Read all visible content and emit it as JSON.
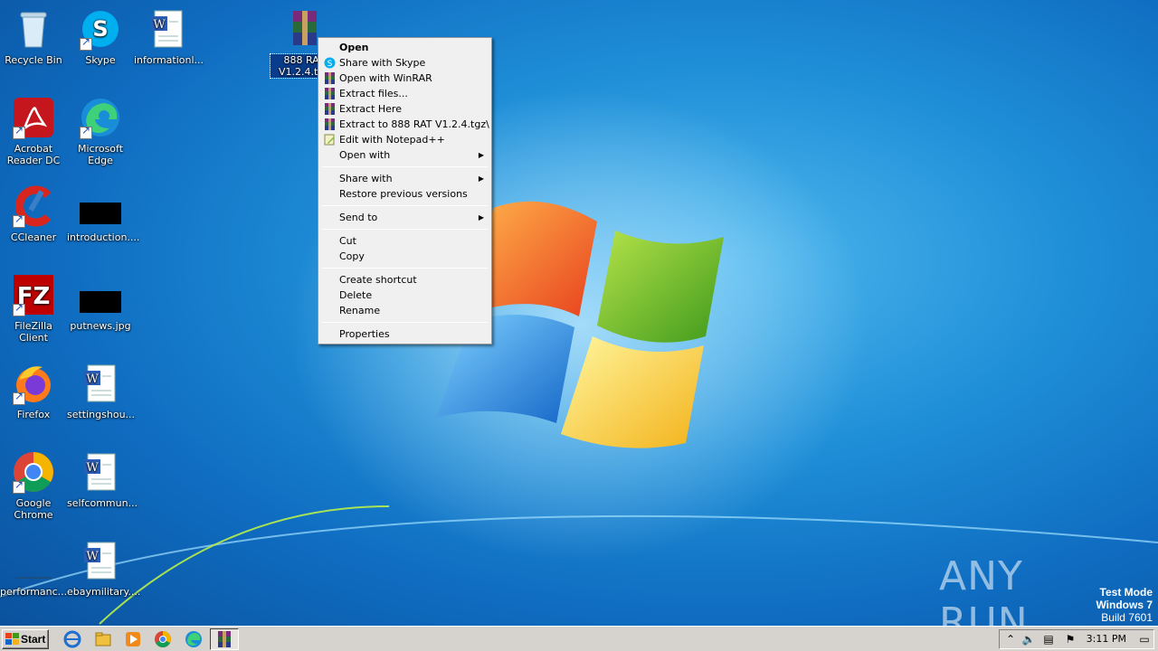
{
  "desktop": {
    "icons": [
      {
        "label": "Recycle Bin"
      },
      {
        "label": "Skype"
      },
      {
        "label": "informationl..."
      },
      {
        "label": "888 RAT V1.2.4.tgz"
      },
      {
        "label": "Acrobat Reader DC"
      },
      {
        "label": "Microsoft Edge"
      },
      {
        "label": "CCleaner"
      },
      {
        "label": "introduction...."
      },
      {
        "label": "FileZilla Client"
      },
      {
        "label": "putnews.jpg"
      },
      {
        "label": "Firefox"
      },
      {
        "label": "settingshou..."
      },
      {
        "label": "Google Chrome"
      },
      {
        "label": "selfcommun..."
      },
      {
        "label": "performanc..."
      },
      {
        "label": "ebaymilitary...."
      }
    ]
  },
  "context_menu": {
    "items": [
      {
        "label": "Open",
        "icon": "none"
      },
      {
        "label": "Share with Skype",
        "icon": "skype-icon"
      },
      {
        "label": "Open with WinRAR",
        "icon": "winrar-icon"
      },
      {
        "label": "Extract files...",
        "icon": "winrar-icon"
      },
      {
        "label": "Extract Here",
        "icon": "winrar-icon"
      },
      {
        "label": "Extract to 888 RAT V1.2.4.tgz\\",
        "icon": "winrar-icon"
      },
      {
        "label": "Edit with Notepad++",
        "icon": "notepadpp-icon"
      },
      {
        "label": "Open with",
        "icon": "submenu-arrow"
      },
      {
        "label": "Share with",
        "icon": "submenu-arrow"
      },
      {
        "label": "Restore previous versions",
        "icon": "none"
      },
      {
        "label": "Send to",
        "icon": "submenu-arrow"
      },
      {
        "label": "Cut",
        "icon": "none"
      },
      {
        "label": "Copy",
        "icon": "none"
      },
      {
        "label": "Create shortcut",
        "icon": "none"
      },
      {
        "label": "Delete",
        "icon": "none"
      },
      {
        "label": "Rename",
        "icon": "none"
      },
      {
        "label": "Properties",
        "icon": "none"
      }
    ]
  },
  "watermark": {
    "text": "ANY RUN"
  },
  "os_info": {
    "line1": "Test Mode",
    "line2": "Windows 7",
    "line3": "Build 7601"
  },
  "taskbar": {
    "start_label": "Start",
    "clock": "3:11 PM",
    "pinned": [
      "internet-explorer-icon",
      "explorer-folder-icon",
      "media-player-icon",
      "chrome-icon",
      "edge-icon",
      "winrar-icon"
    ]
  },
  "colors": {
    "desktop_blue": "#1f8fd8",
    "menu_bg": "#f0f0f0",
    "taskbar_bg": "#d6d3ce",
    "selection_blue": "#0a3c8c"
  }
}
